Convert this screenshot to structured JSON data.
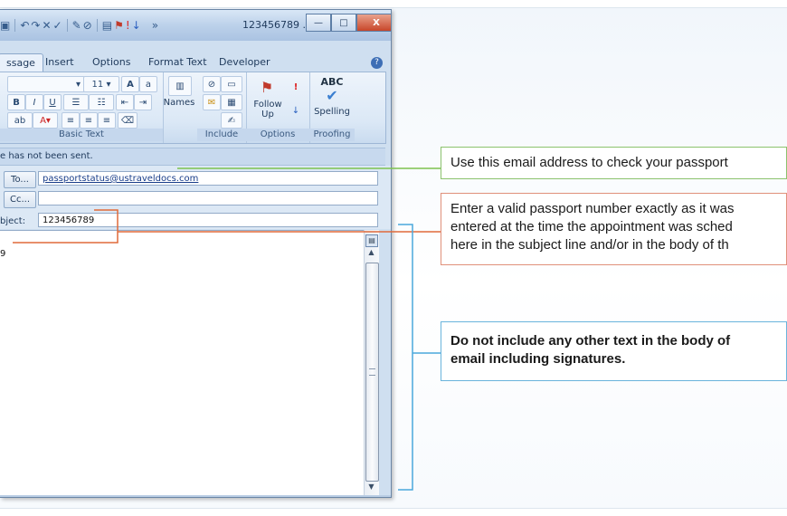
{
  "window": {
    "title": "123456789 ...",
    "overflow_glyph": "»",
    "controls": {
      "minimize": "—",
      "maximize": "□",
      "close": "X"
    }
  },
  "ribbon": {
    "tabs": [
      "ssage",
      "Insert",
      "Options",
      "Format Text",
      "Developer"
    ],
    "active_tab": "ssage",
    "font_size": "11",
    "groups": {
      "basic_text": "Basic Text",
      "include": "Include",
      "options": "Options",
      "proofing": "Proofing"
    },
    "buttons": {
      "names": "Names",
      "follow_up": "Follow\nUp",
      "spelling": "Spelling",
      "abc": "ABC"
    }
  },
  "infobar": {
    "text": "e has not been sent."
  },
  "form": {
    "to_label": "To...",
    "cc_label": "Cc...",
    "subject_label": "bject:",
    "to_value": "passportstatus@ustraveldocs.com",
    "cc_value": "",
    "subject_value": "123456789"
  },
  "body": {
    "text": "9"
  },
  "callouts": {
    "email": "Use this email address to check your passport",
    "passport_line1": "Enter a valid passport number exactly as it was",
    "passport_line2": "entered at the time the appointment was sched",
    "passport_line3": "here in the subject line and/or in the body of th",
    "no_text_line1": "Do not include any other text in the body of",
    "no_text_line2": "email including signatures."
  },
  "colors": {
    "callout_green": "#8cc26d",
    "callout_orange": "#e0907a",
    "callout_blue": "#6ab4dc",
    "line_green": "#7dc24f",
    "line_orange": "#e06a3a",
    "line_blue": "#4aa8dc"
  }
}
